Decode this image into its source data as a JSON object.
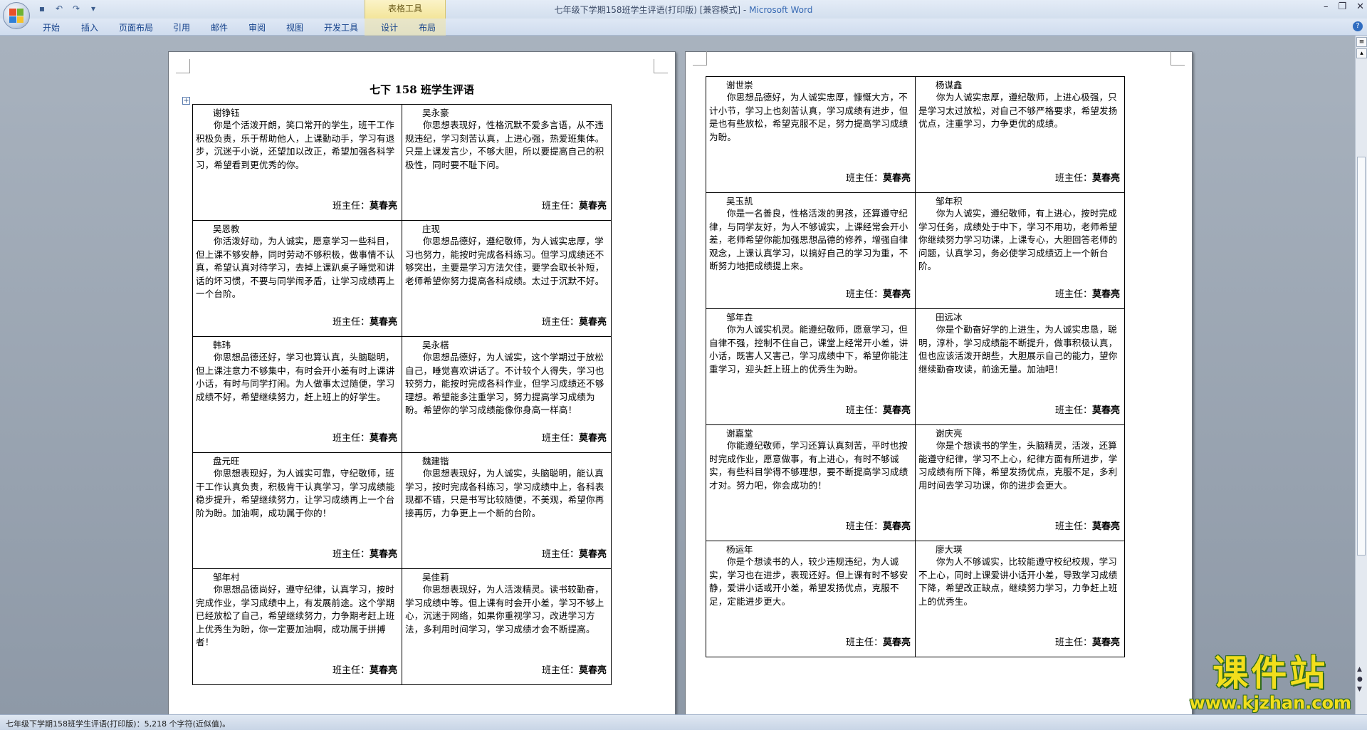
{
  "window": {
    "title": "七年级下学期158班学生评语(打印版) [兼容模式]",
    "app_name": "Microsoft Word",
    "context_tab_group": "表格工具"
  },
  "quick_access": {
    "icons": [
      "save-icon",
      "undo-icon",
      "redo-icon",
      "customize-icon"
    ],
    "save": "▪",
    "undo": "↶",
    "redo": "↷",
    "more": "▾"
  },
  "ribbon": {
    "tabs": [
      "开始",
      "插入",
      "页面布局",
      "引用",
      "邮件",
      "审阅",
      "视图",
      "开发工具",
      "设计",
      "布局"
    ]
  },
  "win_controls": {
    "minimize": "–",
    "restore": "❐",
    "close": "✕"
  },
  "document": {
    "title": "七下 158 班学生评语",
    "sign_label": "班主任：",
    "teacher": "莫春亮"
  },
  "page1": {
    "rows": [
      [
        {
          "name": "谢铮钰",
          "text": "你是个活泼开朗，笑口常开的学生，班干工作积极负责，乐于帮助他人，上课勤动手，学习有退步，沉迷于小说，还望加以改正，希望加强各科学习，希望看到更优秀的你。"
        },
        {
          "name": "吴永豪",
          "text": "你思想表现好，性格沉默不爱多言语，从不违规违纪，学习刻苦认真，上进心强，热爱班集体。只是上课发言少，不够大胆，所以要提高自己的积极性，同时要不耻下问。"
        }
      ],
      [
        {
          "name": "吴恩教",
          "text": "你活泼好动，为人诚实，愿意学习一些科目，但上课不够安静，同时劳动不够积极，做事情不认真，希望认真对待学习，去掉上课趴桌子睡觉和讲话的坏习惯，不要与同学闹矛盾，让学习成绩再上一个台阶。"
        },
        {
          "name": "庄现",
          "text": "你思想品德好，遵纪敬师，为人诚实忠厚，学习也努力，能按时完成各科练习。但学习成绩还不够突出，主要是学习方法欠佳，要学会取长补短，老师希望你努力提高各科成绩。太过于沉默不好。"
        }
      ],
      [
        {
          "name": "韩玮",
          "text": "你思想品德还好，学习也算认真，头脑聪明，但上课注意力不够集中，有时会开小差有时上课讲小话，有时与同学打闹。为人做事太过随便，学习成绩不好，希望继续努力，赶上班上的好学生。"
        },
        {
          "name": "吴永楛",
          "text": "你思想品德好，为人诚实，这个学期过于放松自己，睡觉喜欢讲话了。不计较个人得失，学习也较努力，能按时完成各科作业，但学习成绩还不够理想。希望能多注重学习，努力提高学习成绩为盼。希望你的学习成绩能像你身高一样高！"
        }
      ],
      [
        {
          "name": "盘元旺",
          "text": "你思想表现好，为人诚实可靠，守纪敬师，班干工作认真负责，积极肯干认真学习，学习成绩能稳步提升，希望继续努力，让学习成绩再上一个台阶为盼。加油啊，成功属于你的！"
        },
        {
          "name": "魏建锴",
          "text": "你思想表现好，为人诚实，头脑聪明，能认真学习，按时完成各科练习，学习成绩中上，各科表现都不错，只是书写比较随便，不美观，希望你再接再厉，力争更上一个新的台阶。"
        }
      ],
      [
        {
          "name": "邹年村",
          "text": "你思想品德尚好，遵守纪律，认真学习，按时完成作业，学习成绩中上，有发展前途。这个学期已经放松了自己，希望继续努力，力争期考赶上班上优秀生为盼，你一定要加油啊，成功属于拼搏者！"
        },
        {
          "name": "吴佳莉",
          "text": "你思想表现好，为人活泼精灵。读书较勤奋，学习成绩中等。但上课有时会开小差，学习不够上心，沉迷于网络，如果你重视学习，改进学习方法，多利用时间学习，学习成绩才会不断提高。"
        }
      ]
    ]
  },
  "page2": {
    "rows": [
      [
        {
          "name": "谢世崇",
          "text": "你思想品德好，为人诚实忠厚，慷慨大方，不计小节，学习上也刻苦认真，学习成绩有进步，但是也有些放松，希望克服不足，努力提高学习成绩为盼。"
        },
        {
          "name": "杨谋鑫",
          "text": "你为人诚实忠厚，遵纪敬师，上进心极强，只是学习太过放松，对自己不够严格要求，希望发扬优点，注重学习，力争更优的成绩。"
        }
      ],
      [
        {
          "name": "吴玉凯",
          "text": "你是一名善良，性格活泼的男孩，还算遵守纪律，与同学友好，为人不够诚实，上课经常会开小差，老师希望你能加强思想品德的修养，增强自律观念，上课认真学习，以搞好自己的学习为重，不断努力地把成绩提上来。"
        },
        {
          "name": "邹年积",
          "text": "你为人诚实，遵纪敬师，有上进心，按时完成学习任务，成绩处于中下，学习不用功，老师希望你继续努力学习功课，上课专心，大胆回答老师的问题，认真学习，务必使学习成绩迈上一个新台阶。"
        }
      ],
      [
        {
          "name": "邹年垚",
          "text": "你为人诚实机灵。能遵纪敬师，愿意学习，但自律不强，控制不住自己，课堂上经常开小差，讲小话，既害人又害己，学习成绩中下，希望你能注重学习，迎头赶上班上的优秀生为盼。"
        },
        {
          "name": "田远冰",
          "text": "你是个勤奋好学的上进生，为人诚实忠恳，聪明，淳朴，学习成绩能不断提升，做事积极认真，但也应该活泼开朗些，大胆展示自己的能力，望你继续勤奋攻读，前途无量。加油吧！"
        }
      ],
      [
        {
          "name": "谢嘉堂",
          "text": "你能遵纪敬师，学习还算认真刻苦，平时也按时完成作业，愿意做事，有上进心，有时不够诚实，有些科目学得不够理想，要不断提高学习成绩才对。努力吧，你会成功的！"
        },
        {
          "name": "谢庆亮",
          "text": "你是个想读书的学生，头脑精灵，活泼，还算能遵守纪律，学习不上心，纪律方面有所进步，学习成绩有所下降，希望发扬优点，克服不足，多利用时间去学习功课，你的进步会更大。"
        }
      ],
      [
        {
          "name": "杨运年",
          "text": "你是个想读书的人，较少违规违纪，为人诚实，学习也在进步，表现还好。但上课有时不够安静，爱讲小话或开小差，希望发扬优点，克服不足，定能进步更大。"
        },
        {
          "name": "廖大瑛",
          "text": "你为人不够诚实，比较能遵守校纪校规，学习不上心，同时上课爱讲小话开小差，导致学习成绩下降，希望改正缺点，继续努力学习，力争赶上班上的优秀生。"
        }
      ]
    ]
  },
  "statusbar": {
    "text": "七年级下学期158班学生评语(打印版)：5,218 个字符(近似值)。"
  },
  "watermark": {
    "title": "课件站",
    "url": "www.kjzhan.com"
  },
  "colors": {
    "ribbon_text": "#15428b",
    "context_tab": "#f3e59a",
    "watermark_fill": "#f2de1c"
  }
}
